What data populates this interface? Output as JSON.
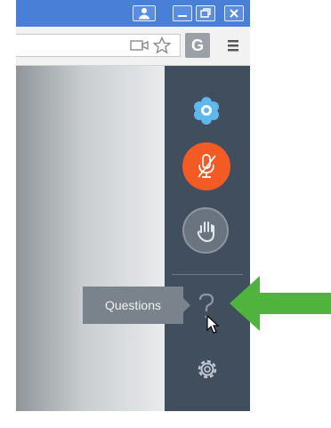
{
  "window": {
    "title_controls": [
      "profile-icon",
      "minimize-icon",
      "restore-icon",
      "close-icon"
    ]
  },
  "toolbar": {
    "profile_letter": "G",
    "icons": [
      "camera-icon",
      "star-icon",
      "menu-icon"
    ]
  },
  "panel": {
    "tooltip": "Questions",
    "accent_colors": {
      "mic": "#f35a24",
      "logo": "#5fb8ec",
      "pointer_arrow": "#4fb33e"
    }
  }
}
